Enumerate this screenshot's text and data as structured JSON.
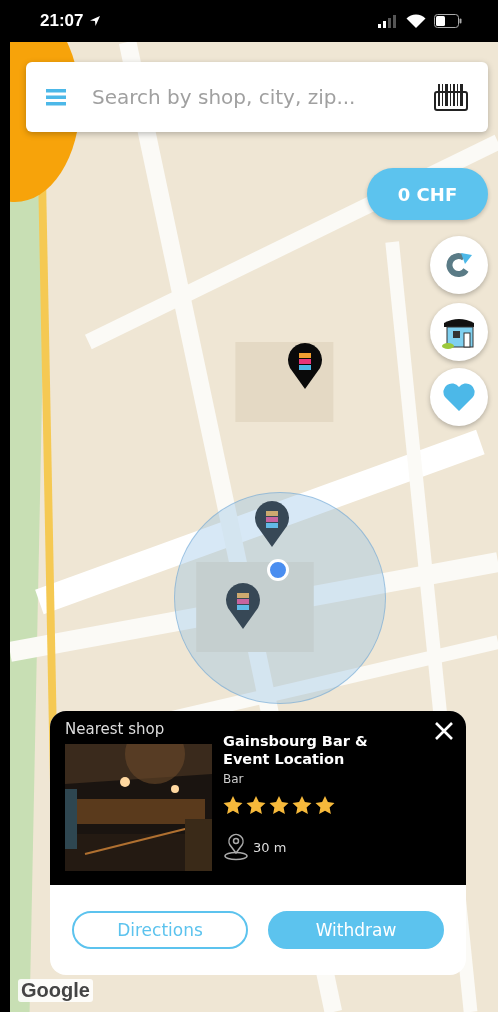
{
  "status_bar": {
    "time": "21:07"
  },
  "search": {
    "placeholder": "Search by shop, city, zip..."
  },
  "balance": "0 CHF",
  "shop_card": {
    "heading": "Nearest shop",
    "name": "Gainsbourg Bar & Event Location",
    "category": "Bar",
    "stars": 5,
    "distance": "30 m",
    "buttons": [
      {
        "label": "Directions",
        "kind": "outline"
      },
      {
        "label": "Withdraw",
        "kind": "filled"
      }
    ]
  },
  "attribution": "Google"
}
